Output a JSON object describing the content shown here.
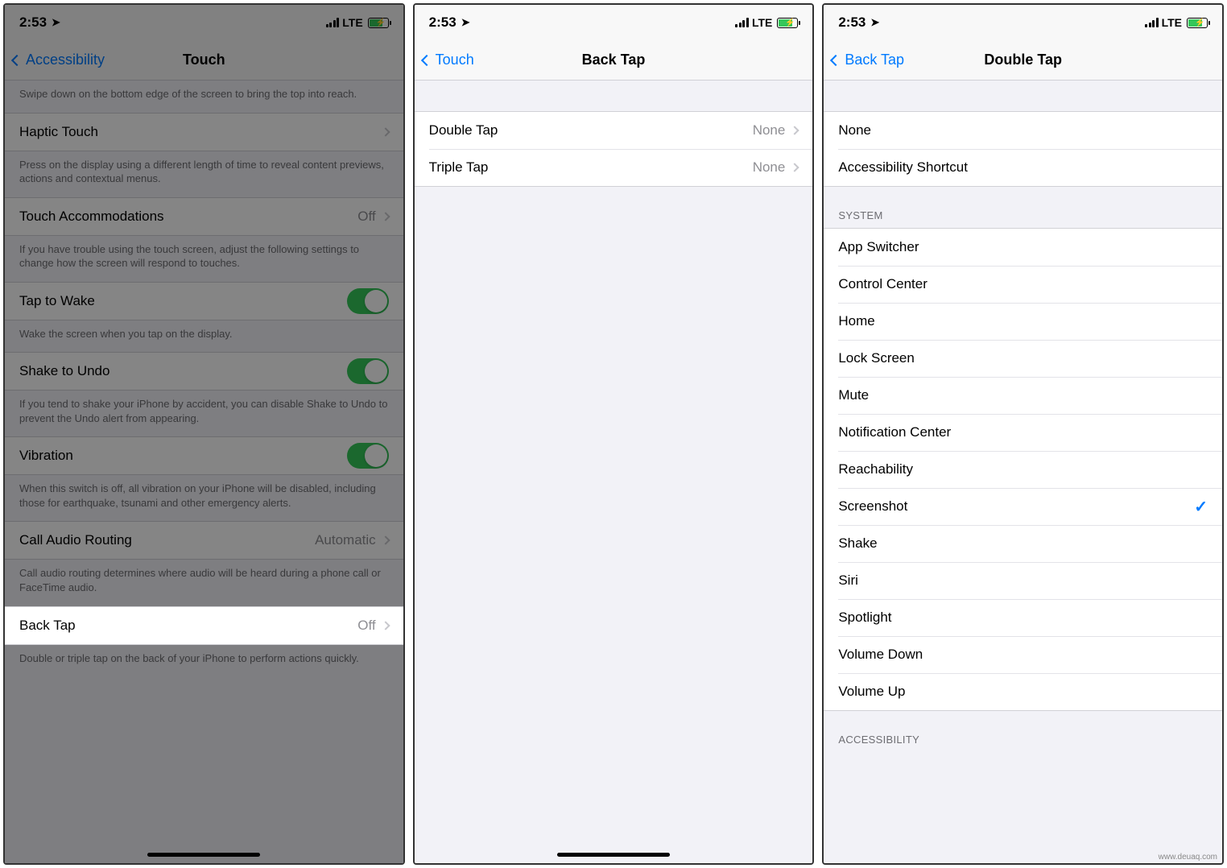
{
  "status": {
    "time": "2:53",
    "network": "LTE"
  },
  "screen1": {
    "back": "Accessibility",
    "title": "Touch",
    "reachability_footer": "Swipe down on the bottom edge of the screen to bring the top into reach.",
    "haptic": {
      "label": "Haptic Touch",
      "footer": "Press on the display using a different length of time to reveal content previews, actions and contextual menus."
    },
    "accommodations": {
      "label": "Touch Accommodations",
      "value": "Off",
      "footer": "If you have trouble using the touch screen, adjust the following settings to change how the screen will respond to touches."
    },
    "taptowake": {
      "label": "Tap to Wake",
      "footer": "Wake the screen when you tap on the display."
    },
    "shake": {
      "label": "Shake to Undo",
      "footer": "If you tend to shake your iPhone by accident, you can disable Shake to Undo to prevent the Undo alert from appearing."
    },
    "vibration": {
      "label": "Vibration",
      "footer": "When this switch is off, all vibration on your iPhone will be disabled, including those for earthquake, tsunami and other emergency alerts."
    },
    "callrouting": {
      "label": "Call Audio Routing",
      "value": "Automatic",
      "footer": "Call audio routing determines where audio will be heard during a phone call or FaceTime audio."
    },
    "backtap": {
      "label": "Back Tap",
      "value": "Off",
      "footer": "Double or triple tap on the back of your iPhone to perform actions quickly."
    }
  },
  "screen2": {
    "back": "Touch",
    "title": "Back Tap",
    "rows": {
      "double": {
        "label": "Double Tap",
        "value": "None"
      },
      "triple": {
        "label": "Triple Tap",
        "value": "None"
      }
    }
  },
  "screen3": {
    "back": "Back Tap",
    "title": "Double Tap",
    "top": {
      "none": "None",
      "shortcut": "Accessibility Shortcut"
    },
    "system_header": "SYSTEM",
    "system": {
      "appswitcher": "App Switcher",
      "controlcenter": "Control Center",
      "home": "Home",
      "lockscreen": "Lock Screen",
      "mute": "Mute",
      "notification": "Notification Center",
      "reachability": "Reachability",
      "screenshot": "Screenshot",
      "shake": "Shake",
      "siri": "Siri",
      "spotlight": "Spotlight",
      "voldown": "Volume Down",
      "volup": "Volume Up"
    },
    "accessibility_header": "ACCESSIBILITY"
  },
  "watermark": "www.deuaq.com"
}
